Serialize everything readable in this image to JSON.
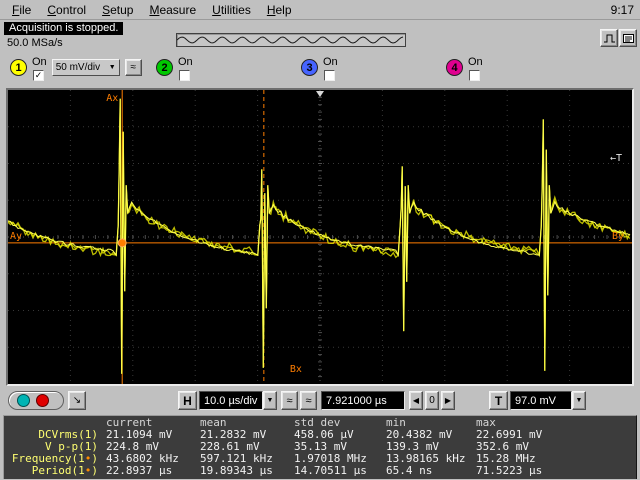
{
  "menu": {
    "items": [
      "File",
      "Control",
      "Setup",
      "Measure",
      "Utilities",
      "Help"
    ],
    "clock": "9:17"
  },
  "status": {
    "message": "Acquisition is stopped.",
    "sample_rate": "50.0 MSa/s"
  },
  "icons": {
    "chevron_down": "▼",
    "left_arrow": "◀",
    "right_arrow": "▶",
    "approx_wave": "≈",
    "pointer_arrow": "↘"
  },
  "channels": [
    {
      "num": "1",
      "on_label": "On",
      "check": "✓",
      "scale": "50 mV/div",
      "color": "#ffff00"
    },
    {
      "num": "2",
      "on_label": "On",
      "check": "",
      "color": "#00c800"
    },
    {
      "num": "3",
      "on_label": "On",
      "check": "",
      "color": "#4664ff"
    },
    {
      "num": "4",
      "on_label": "On",
      "check": "",
      "color": "#e00090"
    }
  ],
  "display": {
    "markers": {
      "ax": "Ax",
      "ay": "Ay",
      "bx": "Bx",
      "by": "By",
      "t_ref": "←T"
    }
  },
  "waveform": {
    "color": "#dede00",
    "highlight": "#ffff55",
    "marker_color": "#ff7e00",
    "spikes_frac": [
      0.183,
      0.41,
      0.635,
      0.861
    ],
    "spike_tops_frac": [
      0.03,
      0.27,
      0.26,
      0.1
    ],
    "spike_bottoms_frac": [
      0.965,
      0.945,
      0.82,
      0.955
    ],
    "pre_spike_frac": -0.045,
    "hump_start_frac": 0.365,
    "hump_end_frac": 0.555,
    "marker_y_frac": 0.52,
    "ax_x_frac": 0.183,
    "bx_x_frac": 0.41,
    "t_ref_y_frac": 0.24
  },
  "timebase": {
    "h_label": "H",
    "scale": "10.0 µs/div",
    "delay": "7.921000 µs",
    "zero_label": "0"
  },
  "trigger": {
    "t_label": "T",
    "level": "97.0 mV"
  },
  "measurements": {
    "headers": [
      "current",
      "mean",
      "std dev",
      "min",
      "max"
    ],
    "rows": [
      {
        "label": "DCVrms(1)",
        "marker": "",
        "label_close": "",
        "values": [
          "21.1094 mV",
          "21.2832 mV",
          "458.06 µV",
          "20.4382 mV",
          "22.6991 mV"
        ]
      },
      {
        "label": "V p-p(1)",
        "marker": "",
        "label_close": "",
        "values": [
          "224.8 mV",
          "228.61 mV",
          "35.13 mV",
          "139.3 mV",
          "352.6 mV"
        ]
      },
      {
        "label": "Frequency(1",
        "marker": "•",
        "label_close": ")",
        "values": [
          "43.6802 kHz",
          "597.121 kHz",
          "1.97018 MHz",
          "13.98165 kHz",
          "15.28 MHz"
        ]
      },
      {
        "label": "Period(1",
        "marker": "•",
        "label_close": ")",
        "values": [
          "22.8937 µs",
          "19.89343 µs",
          "14.70511 µs",
          "65.4 ns",
          "71.5223 µs"
        ]
      }
    ]
  }
}
